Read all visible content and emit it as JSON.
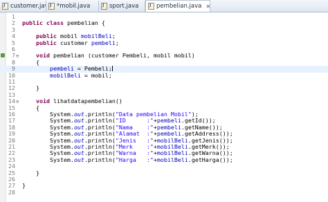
{
  "tabs": [
    {
      "label": "customer.java",
      "active": false
    },
    {
      "label": "*mobil.java",
      "active": false
    },
    {
      "label": "sport.java",
      "active": false
    },
    {
      "label": "pembelian.java",
      "active": true,
      "close": "✕"
    }
  ],
  "lines": [
    {
      "n": "1",
      "code": [
        {
          "t": ""
        }
      ]
    },
    {
      "n": "2",
      "code": [
        {
          "t": "public",
          "c": "kw"
        },
        {
          "t": " "
        },
        {
          "t": "class",
          "c": "kw"
        },
        {
          "t": " pembelian {"
        }
      ]
    },
    {
      "n": "3",
      "code": [
        {
          "t": ""
        }
      ]
    },
    {
      "n": "4",
      "code": [
        {
          "t": "    "
        },
        {
          "t": "public",
          "c": "kw"
        },
        {
          "t": " mobil "
        },
        {
          "t": "mobilBeli",
          "c": "fld"
        },
        {
          "t": ";"
        }
      ]
    },
    {
      "n": "5",
      "code": [
        {
          "t": "    "
        },
        {
          "t": "public",
          "c": "kw"
        },
        {
          "t": " customer "
        },
        {
          "t": "pembeli",
          "c": "fld"
        },
        {
          "t": ";"
        }
      ]
    },
    {
      "n": "6",
      "code": [
        {
          "t": ""
        }
      ]
    },
    {
      "n": "7",
      "fold": "⊖",
      "marker": true,
      "code": [
        {
          "t": "    "
        },
        {
          "t": "void",
          "c": "kw"
        },
        {
          "t": " pembelian (customer Pembeli, mobil mobil)"
        }
      ]
    },
    {
      "n": "8",
      "code": [
        {
          "t": "    {"
        }
      ]
    },
    {
      "n": "9",
      "cur": true,
      "code": [
        {
          "t": "        "
        },
        {
          "t": "pembeli",
          "c": "fld"
        },
        {
          "t": " = Pembeli;",
          "caret": true
        }
      ]
    },
    {
      "n": "10",
      "code": [
        {
          "t": "        "
        },
        {
          "t": "mobilBeli",
          "c": "fld"
        },
        {
          "t": " = mobil;"
        }
      ]
    },
    {
      "n": "11",
      "code": [
        {
          "t": ""
        }
      ]
    },
    {
      "n": "12",
      "code": [
        {
          "t": "    }"
        }
      ]
    },
    {
      "n": "13",
      "code": [
        {
          "t": ""
        }
      ]
    },
    {
      "n": "14",
      "fold": "⊖",
      "code": [
        {
          "t": "    "
        },
        {
          "t": "void",
          "c": "kw"
        },
        {
          "t": " lihatdatapembelian()"
        }
      ]
    },
    {
      "n": "15",
      "code": [
        {
          "t": "    {"
        }
      ]
    },
    {
      "n": "16",
      "code": [
        {
          "t": "        System."
        },
        {
          "t": "out",
          "c": "sfld"
        },
        {
          "t": ".println("
        },
        {
          "t": "\"Data pembelian Mobil\"",
          "c": "str"
        },
        {
          "t": ");"
        }
      ]
    },
    {
      "n": "17",
      "code": [
        {
          "t": "        System."
        },
        {
          "t": "out",
          "c": "sfld"
        },
        {
          "t": ".println("
        },
        {
          "t": "\"ID      :\"",
          "c": "str"
        },
        {
          "t": "+"
        },
        {
          "t": "pembeli",
          "c": "fld"
        },
        {
          "t": ".getId());"
        }
      ]
    },
    {
      "n": "18",
      "code": [
        {
          "t": "        System."
        },
        {
          "t": "out",
          "c": "sfld"
        },
        {
          "t": ".println("
        },
        {
          "t": "\"Nama    :\"",
          "c": "str"
        },
        {
          "t": "+"
        },
        {
          "t": "pembeli",
          "c": "fld"
        },
        {
          "t": ".getName());"
        }
      ]
    },
    {
      "n": "19",
      "code": [
        {
          "t": "        System."
        },
        {
          "t": "out",
          "c": "sfld"
        },
        {
          "t": ".println("
        },
        {
          "t": "\"Alamat  :\"",
          "c": "str"
        },
        {
          "t": "+"
        },
        {
          "t": "pembeli",
          "c": "fld"
        },
        {
          "t": ".getAddress());"
        }
      ]
    },
    {
      "n": "20",
      "code": [
        {
          "t": "        System."
        },
        {
          "t": "out",
          "c": "sfld"
        },
        {
          "t": ".println("
        },
        {
          "t": "\"Jenis   :\"",
          "c": "str"
        },
        {
          "t": "+"
        },
        {
          "t": "mobilBeli",
          "c": "fld"
        },
        {
          "t": ".getJenis());"
        }
      ]
    },
    {
      "n": "21",
      "code": [
        {
          "t": "        System."
        },
        {
          "t": "out",
          "c": "sfld"
        },
        {
          "t": ".println("
        },
        {
          "t": "\"Merk    :\"",
          "c": "str"
        },
        {
          "t": "+"
        },
        {
          "t": "mobilBeli",
          "c": "fld"
        },
        {
          "t": ".getMerk());"
        }
      ]
    },
    {
      "n": "22",
      "code": [
        {
          "t": "        System."
        },
        {
          "t": "out",
          "c": "sfld"
        },
        {
          "t": ".println("
        },
        {
          "t": "\"Warna   :\"",
          "c": "str"
        },
        {
          "t": "+"
        },
        {
          "t": "mobilBeli",
          "c": "fld"
        },
        {
          "t": ".getWarna());"
        }
      ]
    },
    {
      "n": "23",
      "code": [
        {
          "t": "        System."
        },
        {
          "t": "out",
          "c": "sfld"
        },
        {
          "t": ".println("
        },
        {
          "t": "\"Harga   :\"",
          "c": "str"
        },
        {
          "t": "+"
        },
        {
          "t": "mobilBeli",
          "c": "fld"
        },
        {
          "t": ".getHarga());"
        }
      ]
    },
    {
      "n": "24",
      "code": [
        {
          "t": ""
        }
      ]
    },
    {
      "n": "25",
      "code": [
        {
          "t": "    }"
        }
      ]
    },
    {
      "n": "26",
      "code": [
        {
          "t": ""
        }
      ]
    },
    {
      "n": "27",
      "code": [
        {
          "t": "}"
        }
      ]
    },
    {
      "n": "28",
      "code": [
        {
          "t": ""
        }
      ]
    }
  ]
}
